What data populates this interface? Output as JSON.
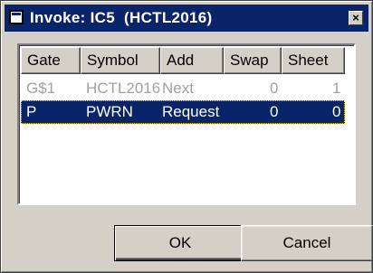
{
  "window": {
    "title": "Invoke: IC5  (HCTL2016)",
    "close_glyph": "×"
  },
  "table": {
    "columns": [
      "Gate",
      "Symbol",
      "Add",
      "Swap",
      "Sheet"
    ],
    "rows": [
      {
        "gate": "G$1",
        "symbol": "HCTL2016",
        "add": "Next",
        "swap": "0",
        "sheet": "1",
        "state": "disabled"
      },
      {
        "gate": "P",
        "symbol": "PWRN",
        "add": "Request",
        "swap": "0",
        "sheet": "0",
        "state": "selected"
      }
    ]
  },
  "buttons": {
    "ok_label": "OK",
    "cancel_label": "Cancel"
  },
  "colors": {
    "titlebar": "#0a246a",
    "selection": "#0a246a",
    "face": "#d4d0c8",
    "disabled_text": "#a0a0a0"
  }
}
